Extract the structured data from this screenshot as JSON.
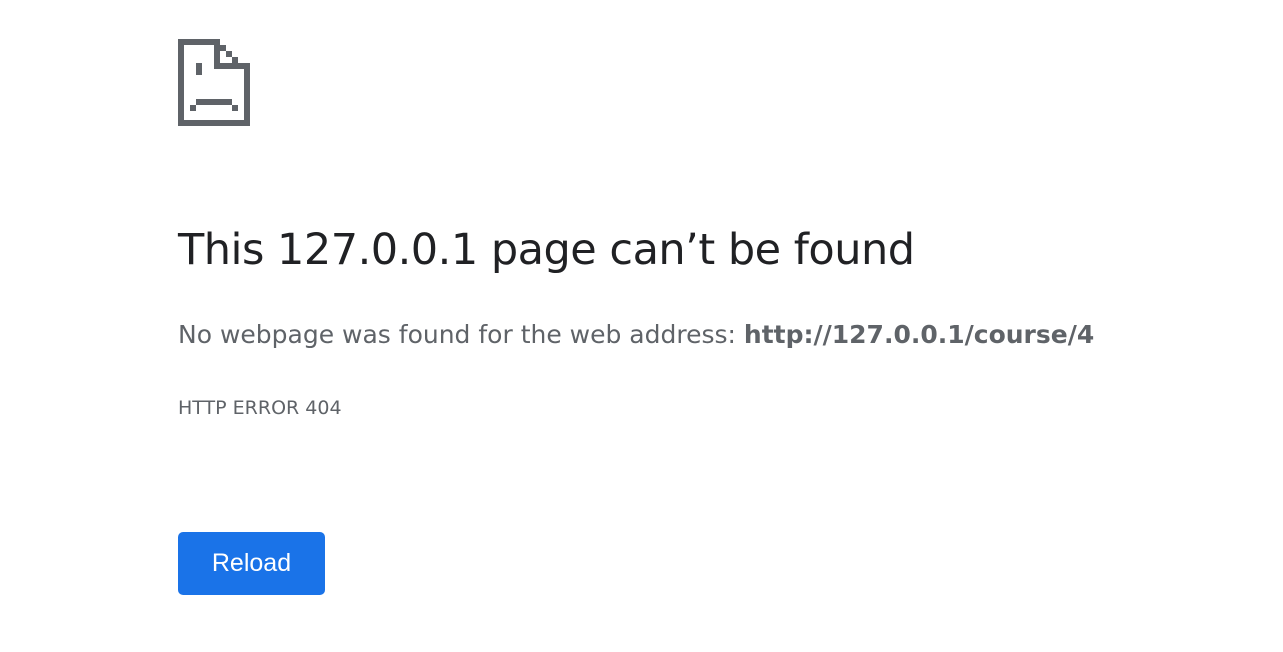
{
  "error": {
    "icon": "sad-document-icon",
    "title": "This 127.0.0.1 page can’t be found",
    "summary_prefix": "No webpage was found for the web address: ",
    "url": "http://127.0.0.1/course/4",
    "code": "HTTP ERROR 404"
  },
  "actions": {
    "reload_label": "Reload"
  },
  "colors": {
    "background": "#ffffff",
    "title": "#202124",
    "secondary_text": "#5f6368",
    "icon": "#5f6368",
    "button": "#1a73e8",
    "button_text": "#ffffff"
  }
}
